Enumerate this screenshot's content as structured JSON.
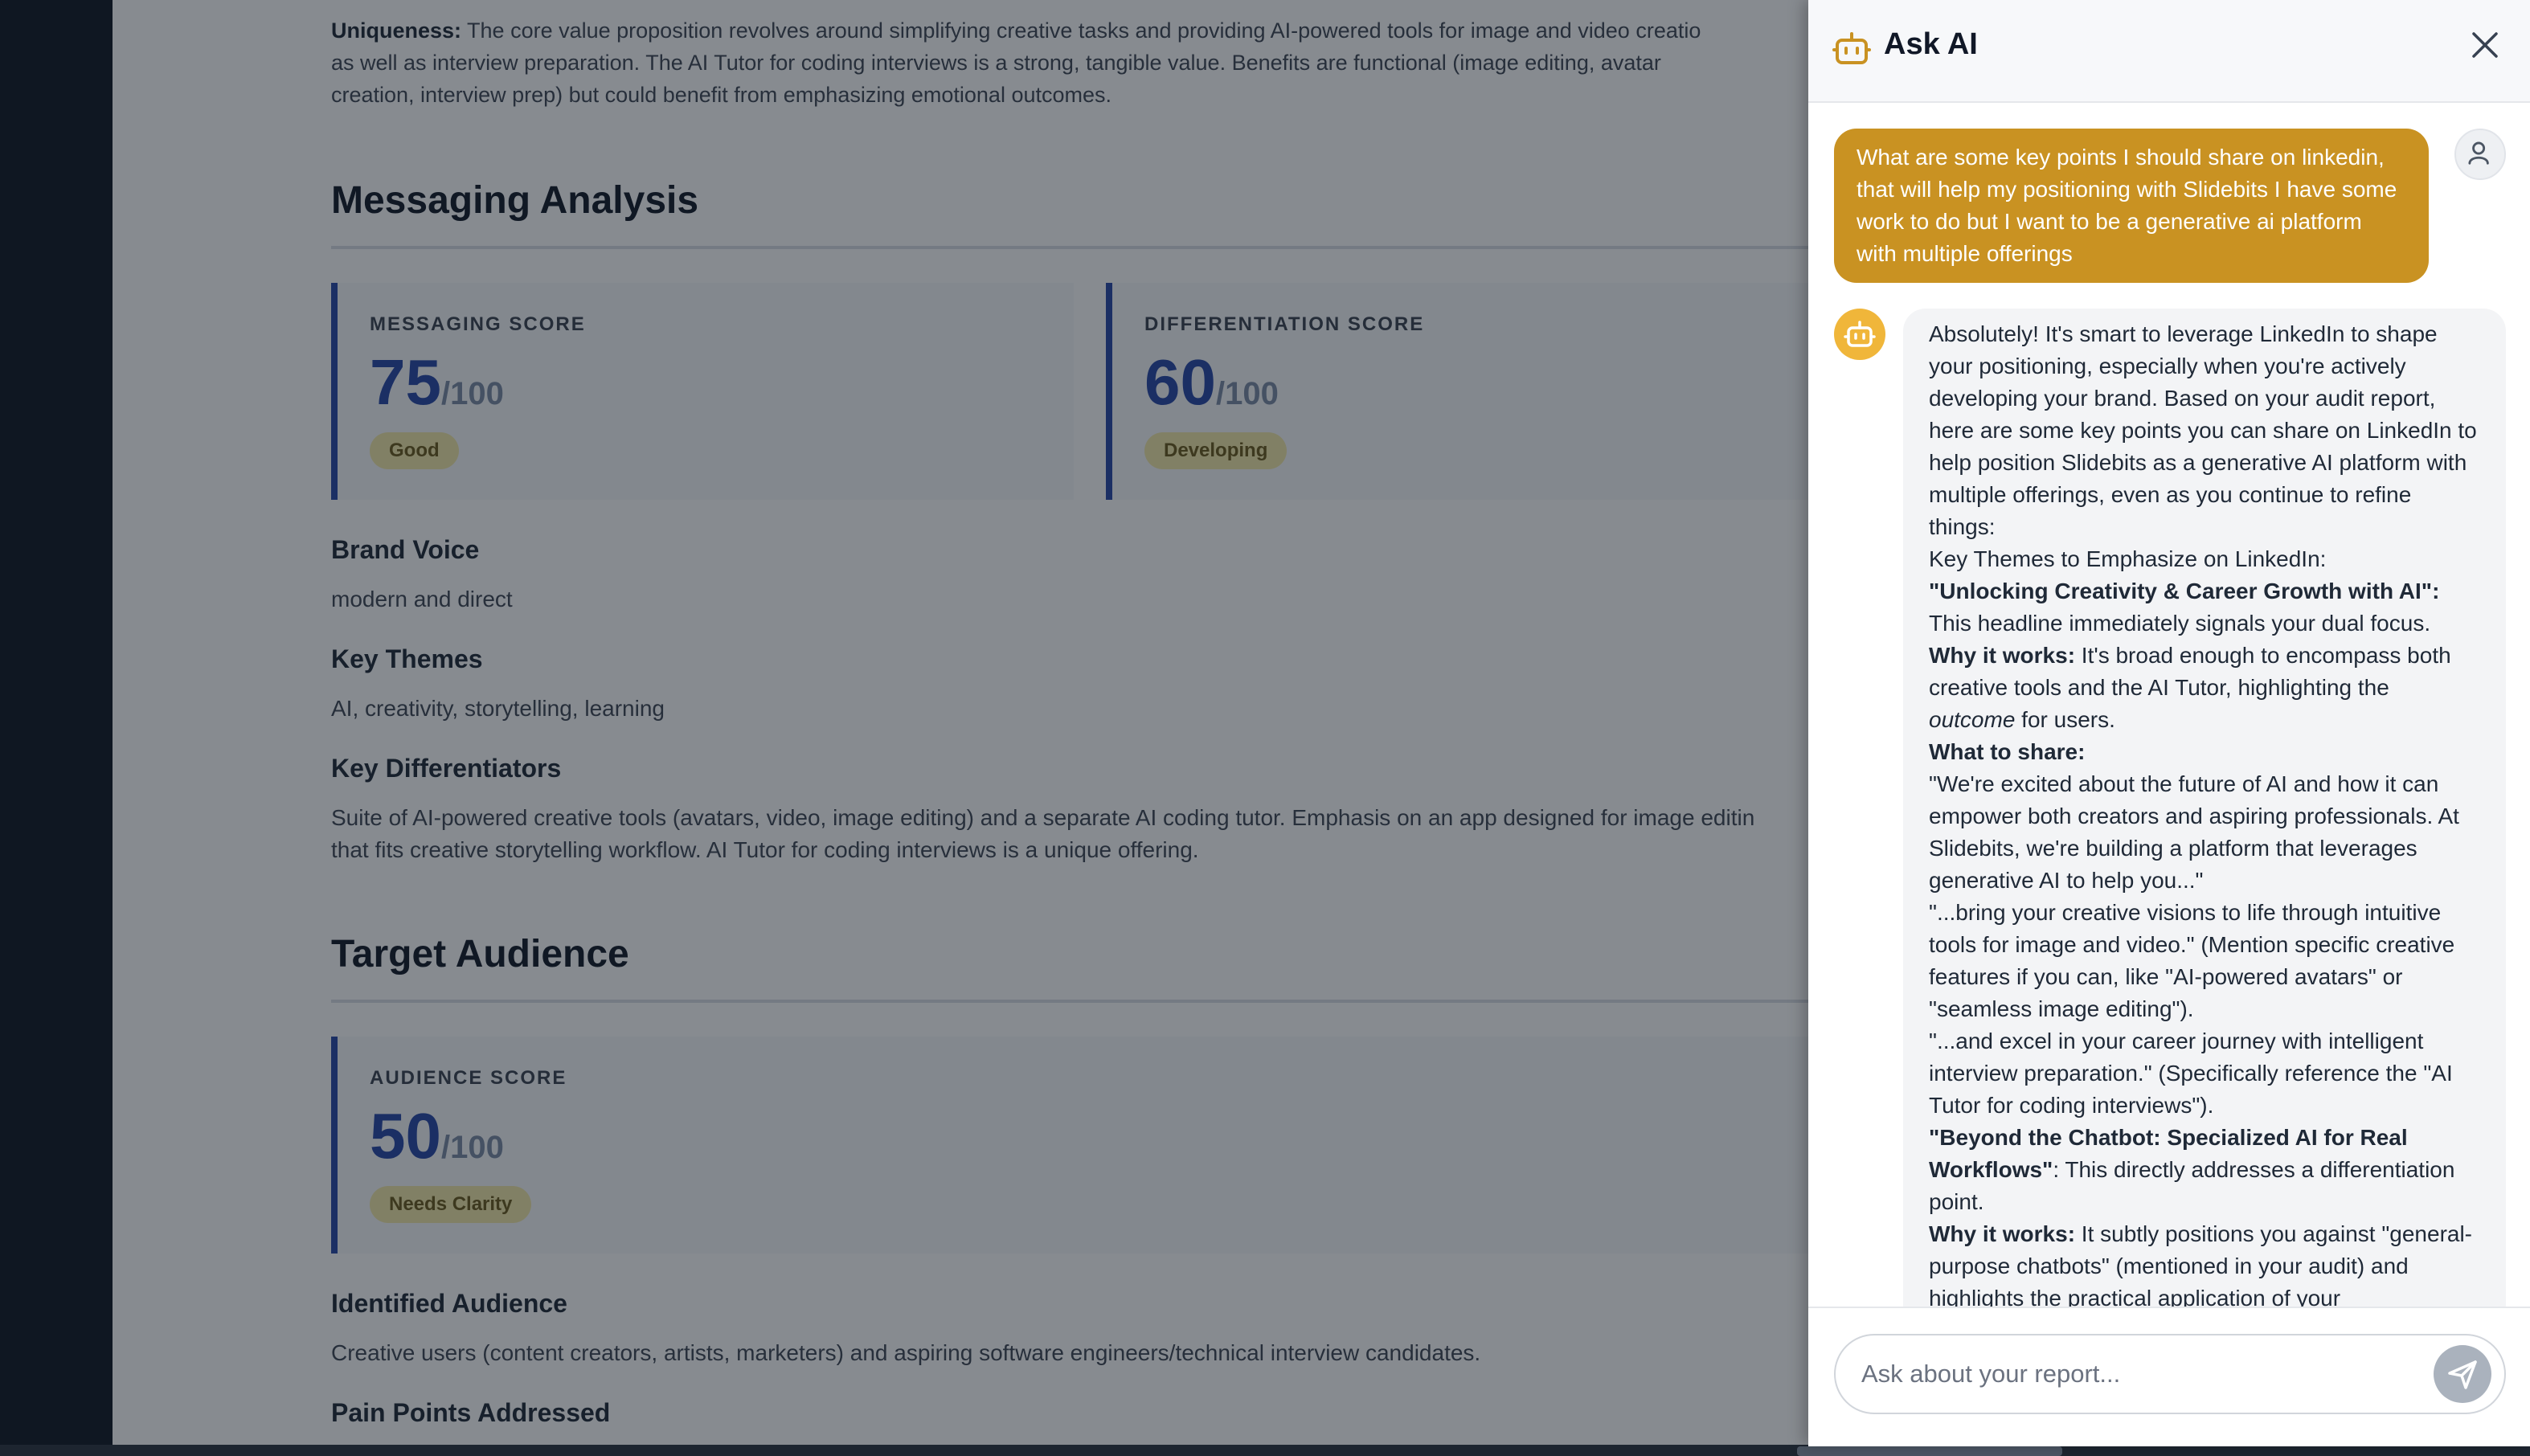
{
  "report": {
    "uniqueness": {
      "label": "Uniqueness:",
      "line1": " The core value proposition revolves around simplifying creative tasks and providing AI-powered tools for image and video creatio",
      "line2": "as well as interview preparation. The AI Tutor for coding interviews is a strong, tangible value. Benefits are functional (image editing, avatar",
      "line3": "creation, interview prep) but could benefit from emphasizing emotional outcomes."
    },
    "messaging": {
      "title": "Messaging Analysis",
      "cards": [
        {
          "label": "MESSAGING SCORE",
          "value": "75",
          "max": "/100",
          "badge": "Good"
        },
        {
          "label": "DIFFERENTIATION SCORE",
          "value": "60",
          "max": "/100",
          "badge": "Developing"
        }
      ],
      "brand_voice": {
        "heading": "Brand Voice",
        "text": "modern and direct"
      },
      "key_themes": {
        "heading": "Key Themes",
        "text": "AI, creativity, storytelling, learning"
      },
      "key_differentiators": {
        "heading": "Key Differentiators",
        "line1": "Suite of AI-powered creative tools (avatars, video, image editing) and a separate AI coding tutor. Emphasis on an app designed for image editin",
        "line2": "that fits creative storytelling workflow. AI Tutor for coding interviews is a unique offering."
      }
    },
    "audience": {
      "title": "Target Audience",
      "card": {
        "label": "AUDIENCE SCORE",
        "value": "50",
        "max": "/100",
        "badge": "Needs Clarity"
      },
      "identified": {
        "heading": "Identified Audience",
        "text": "Creative users (content creators, artists, marketers) and aspiring software engineers/technical interview candidates."
      },
      "pain_points": {
        "heading": "Pain Points Addressed"
      }
    }
  },
  "chat": {
    "title": "Ask AI",
    "user_message": "What are some key points I should share on linkedin, that will help my positioning with Slidebits I have some work to do but I want to be a generative ai platform with multiple offerings",
    "bot": {
      "intro": "Absolutely! It's smart to leverage LinkedIn to shape your positioning, especially when you're actively developing your brand. Based on your audit report, here are some key points you can share on LinkedIn to help position Slidebits as a generative AI platform with multiple offerings, even as you continue to refine things:",
      "themes_heading": "Key Themes to Emphasize on LinkedIn:",
      "point1_title": "\"Unlocking Creativity & Career Growth with AI\":",
      "point1_text": "This headline immediately signals your dual focus.",
      "why1_label": "Why it works:",
      "why1_text_a": " It's broad enough to encompass both creative tools and the AI Tutor, highlighting the ",
      "why1_em": "outcome",
      "why1_text_b": " for users.",
      "what_label": "What to share:",
      "quote1": "\"We're excited about the future of AI and how it can empower both creators and aspiring professionals. At Slidebits, we're building a platform that leverages generative AI to help you...\"",
      "quote2": "\"...bring your creative visions to life through intuitive tools for image and video.\" (Mention specific creative features if you can, like \"AI-powered avatars\" or \"seamless image editing\").",
      "quote3": "\"...and excel in your career journey with intelligent interview preparation.\" (Specifically reference the \"AI Tutor for coding interviews\").",
      "point2_title": "\"Beyond the Chatbot: Specialized AI for Real Workflows\"",
      "point2_text": ": This directly addresses a differentiation point.",
      "why2_label": "Why it works:",
      "why2_text": " It subtly positions you against \"general-purpose chatbots\" (mentioned in your audit) and highlights the practical application of your"
    },
    "input_placeholder": "Ask about your report...",
    "colors": {
      "user_bubble": "#c99222",
      "score_accent": "#2747a6",
      "bot_avatar": "#f0b63a"
    }
  }
}
